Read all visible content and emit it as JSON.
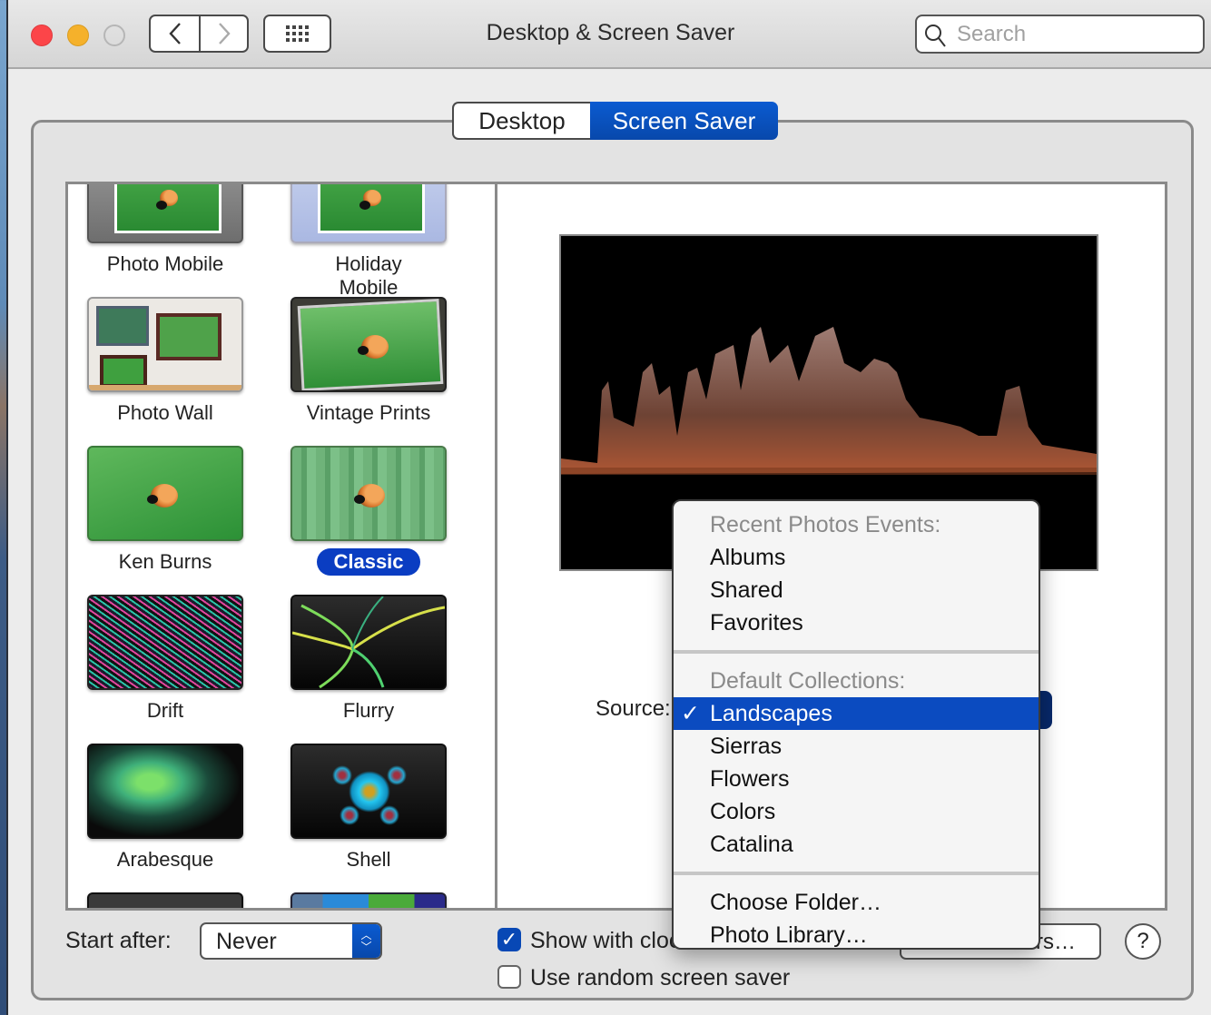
{
  "window": {
    "title": "Desktop & Screen Saver",
    "search_placeholder": "Search",
    "back_icon": "chevron-left-icon",
    "forward_icon": "chevron-right-icon",
    "grid_icon": "show-all-grid-icon"
  },
  "tabs": [
    {
      "label": "Desktop",
      "selected": false
    },
    {
      "label": "Screen Saver",
      "selected": true
    }
  ],
  "screensavers": [
    {
      "label": "Photo Mobile",
      "selected": false
    },
    {
      "label": "Holiday Mobile",
      "selected": false
    },
    {
      "label": "Photo Wall",
      "selected": false
    },
    {
      "label": "Vintage Prints",
      "selected": false
    },
    {
      "label": "Ken Burns",
      "selected": false
    },
    {
      "label": "Classic",
      "selected": true
    },
    {
      "label": "Drift",
      "selected": false
    },
    {
      "label": "Flurry",
      "selected": false
    },
    {
      "label": "Arabesque",
      "selected": false
    },
    {
      "label": "Shell",
      "selected": false
    }
  ],
  "preview": {
    "source_label": "Source:"
  },
  "source_menu": {
    "sections": [
      {
        "header": "Recent Photos Events:",
        "items": [
          "Albums",
          "Shared",
          "Favorites"
        ]
      },
      {
        "header": "Default Collections:",
        "items": [
          "Landscapes",
          "Sierras",
          "Flowers",
          "Colors",
          "Catalina"
        ]
      },
      {
        "header": null,
        "items": [
          "Choose Folder…",
          "Photo Library…"
        ]
      }
    ],
    "selected": "Landscapes",
    "check_glyph": "✓"
  },
  "bottom": {
    "start_after_label": "Start after:",
    "start_after_value": "Never",
    "show_with_clock_label": "Show with clock",
    "show_with_clock_checked": true,
    "random_label": "Use random screen saver",
    "random_checked": false,
    "hot_corners_label": "Hot Corners…",
    "help_label": "?"
  },
  "colors": {
    "accent": "#0b4bc0",
    "close": "#fc4549",
    "minimize": "#f5b12b"
  }
}
